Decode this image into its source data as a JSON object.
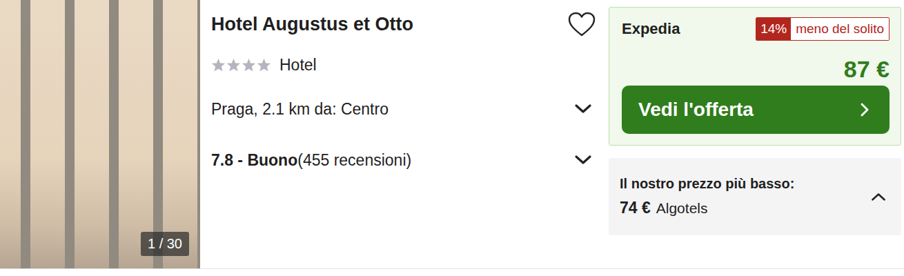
{
  "hotel": {
    "name": "Hotel Augustus et Otto",
    "stars": 4,
    "type": "Hotel",
    "favorite": false
  },
  "photo": {
    "counter": "1 / 30"
  },
  "location": {
    "text": "Praga, 2.1 km da: Centro",
    "expanded": false
  },
  "rating": {
    "score_label": "7.8 - Buono",
    "reviews": "(455 recensioni)",
    "expanded": false
  },
  "deal": {
    "provider": "Expedia",
    "discount": "14%",
    "discount_note": "meno del solito",
    "price": "87 €",
    "button": "Vedi l'offerta"
  },
  "lowest": {
    "label": "Il nostro prezzo più basso:",
    "price": "74 €",
    "provider": "Algotels",
    "expanded": true
  }
}
